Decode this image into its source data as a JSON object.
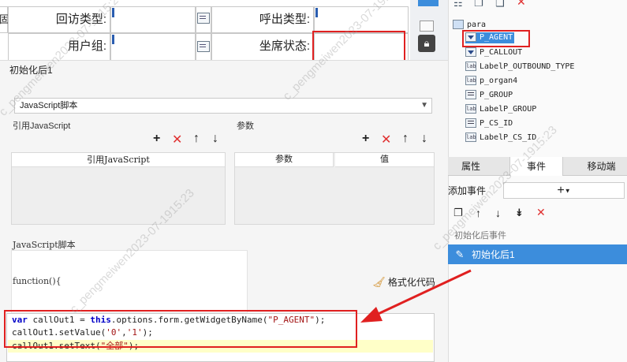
{
  "form": {
    "callback_type_label": "回访类型:",
    "callout_type_label": "呼出类型:",
    "user_group_label": "用户组:",
    "agent_status_label": "坐席状态:"
  },
  "dialog": {
    "title": "初始化后1",
    "script_type": "JavaScript脚本",
    "ref_js_label": "引用JavaScript",
    "params_label": "参数",
    "ref_js_column": "引用JavaScript",
    "param_column": "参数",
    "value_column": "值",
    "script_label": "JavaScript脚本",
    "function_header": "function(){",
    "format_code_label": "格式化代码",
    "code": {
      "line1_kw": "var",
      "line1_a": " callOut1 = ",
      "line1_this": "this",
      "line1_b": ".options.form.getWidgetByName(",
      "line1_str": "\"P_AGENT\"",
      "line1_c": ");",
      "line2_a": "callOut1.setValue(",
      "line2_s1": "'0'",
      "line2_b": ",",
      "line2_s2": "'1'",
      "line2_c": ");",
      "line3_a": "callOut1.setText(",
      "line3_str": "\"全部\"",
      "line3_c": ");"
    }
  },
  "tree": {
    "root": "para",
    "items": [
      "P_AGENT",
      "P_CALLOUT",
      "LabelP_OUTBOUND_TYPE",
      "p_organ4",
      "P_GROUP",
      "LabelP_GROUP",
      "P_CS_ID",
      "LabelP_CS_ID"
    ]
  },
  "tabs": {
    "attributes": "属性",
    "events": "事件",
    "mobile": "移动端"
  },
  "events": {
    "add_event_label": "添加事件",
    "after_init_category": "初始化后事件",
    "selected_event": "初始化后1"
  },
  "watermark_text": "c_pengmeiwen2023-07-1915:23",
  "colors": {
    "accent": "#3c8ddc",
    "highlight_box": "#e02020",
    "delete_red": "#e03030"
  }
}
